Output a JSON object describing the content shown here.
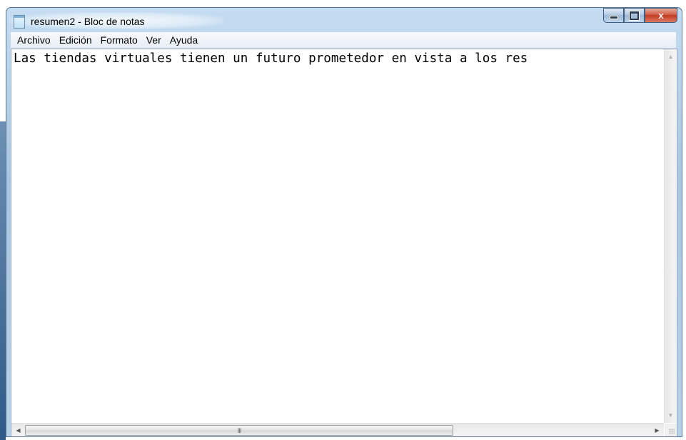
{
  "window": {
    "title": "resumen2 - Bloc de notas",
    "close_glyph": "x"
  },
  "menu": {
    "items": [
      "Archivo",
      "Edición",
      "Formato",
      "Ver",
      "Ayuda"
    ]
  },
  "editor": {
    "content": "Las tiendas virtuales tienen un futuro prometedor en vista a los res"
  },
  "scrollbar": {
    "thumb_grip": "III"
  },
  "colors": {
    "titlebar": "#b7d1ea",
    "close_button": "#c23b22",
    "menubar": "#f0f4f9"
  }
}
